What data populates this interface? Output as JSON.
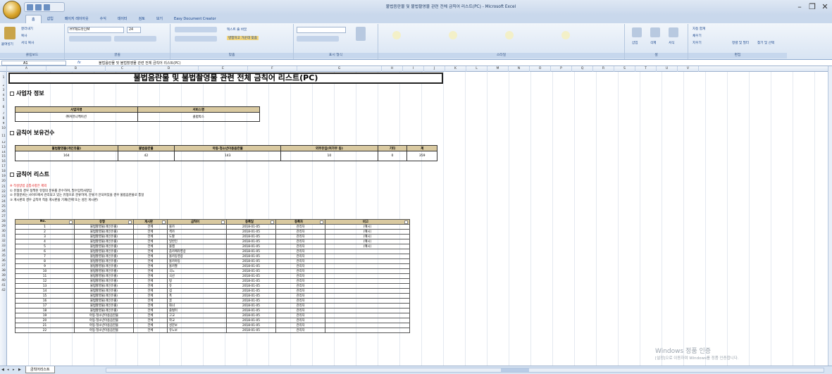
{
  "window": {
    "title": "불법음란물 및 불법촬영물 관련 전체 금칙어 리스트(PC) - Microsoft Excel"
  },
  "ribbon": {
    "tabs": [
      "홈",
      "삽입",
      "페이지 레이아웃",
      "수식",
      "데이터",
      "검토",
      "보기",
      "Easy Document Creator"
    ],
    "paste_label": "붙여넣기",
    "clipboard_items": [
      "잘라내기",
      "복사",
      "서식 복사"
    ],
    "font_name": "HY헤드라인M",
    "font_size": "24",
    "wrap_text": "텍스트 줄 바꿈",
    "merge_center": "병합하고 가운데 맞춤",
    "number_format": "",
    "insert": "삽입",
    "delete": "삭제",
    "format": "서식",
    "autosum": "자동 합계",
    "fill": "채우기",
    "clear": "지우기",
    "sort_filter": "정렬 및 필터",
    "find_select": "찾기 및 선택",
    "groups": [
      "클립보드",
      "글꼴",
      "맞춤",
      "표시 형식",
      "스타일",
      "셀",
      "편집"
    ]
  },
  "formula_bar": {
    "name_box": "A1",
    "fx": "fx",
    "value": "불법음란물 및 불법촬영물 관련 전체 금칙어 리스트(PC)"
  },
  "columns": [
    "A",
    "B",
    "C",
    "D",
    "E",
    "F",
    "G",
    "H",
    "I",
    "J",
    "K",
    "L",
    "M",
    "N",
    "O",
    "P",
    "Q",
    "R",
    "S",
    "T",
    "U",
    "V"
  ],
  "rows": [
    "1",
    "2",
    "3",
    "4",
    "5",
    "6",
    "7",
    "8",
    "9",
    "10",
    "11",
    "12",
    "13",
    "14",
    "15",
    "16",
    "17",
    "18",
    "19",
    "20",
    "21",
    "22",
    "23",
    "24",
    "25",
    "26",
    "27",
    "28",
    "29",
    "30",
    "31",
    "32",
    "33",
    "34",
    "35",
    "36",
    "37",
    "38",
    "39",
    "40",
    "41",
    "42"
  ],
  "sheet": {
    "title": "불법음란물 및 불법촬영물 관련 전체 금칙어 리스트(PC)",
    "section1": "사업자 정보",
    "biz_headers": [
      "사업자명",
      "서비스명"
    ],
    "biz_values": [
      "㈜커뮤니케이션",
      "클럽박스"
    ],
    "section2": "금칙어 보유건수",
    "count_headers": [
      "불법촬영물(개인유출)",
      "불법음란물",
      "아동·청소년이용음란물",
      "외부유입(여가부 등)",
      "기타",
      "계"
    ],
    "count_values": [
      "164",
      "42",
      "143",
      "10",
      "0",
      "359"
    ],
    "section3": "금칙어 리스트",
    "notes_red": "※ 작성방법 공통사항은 제외",
    "notes": [
      "① 유형의 경우 정책된 유형의 분류를 준수하며, 필수입력사항임",
      "② 유형분류는 사이트에서 관리되고 있는 유형으로 분류하며, 분류가 안되어있을 경우 불법음란물로 통일",
      "③ 게시판의 경우 금칙어 적용 게시판을 기재(전체 또는 성인 게시판)"
    ],
    "list_headers": [
      "No.",
      "유형",
      "게시판",
      "금칙어",
      "등록일",
      "등록자",
      "비고"
    ],
    "list_rows": [
      [
        "1",
        "불법촬영물(개인유출)",
        "전체",
        "몰카",
        "2018-01-05",
        "관리자",
        "(예시)"
      ],
      [
        "2",
        "불법촬영물(개인유출)",
        "전체",
        "섹카",
        "2018-01-05",
        "관리자",
        "(예시)"
      ],
      [
        "3",
        "불법촬영물(개인유출)",
        "전체",
        "도촬",
        "2018-01-05",
        "관리자",
        "(예시)"
      ],
      [
        "4",
        "불법촬영물(개인유출)",
        "전체",
        "일반인",
        "2018-01-05",
        "관리자",
        "(예시)"
      ],
      [
        "5",
        "불법촬영물(개인유출)",
        "전체",
        "몰캠",
        "2018-01-05",
        "관리자",
        "(예시)"
      ],
      [
        "6",
        "불법촬영물(개인유출)",
        "전체",
        "줌카메라영상",
        "2018-01-05",
        "관리자",
        ""
      ],
      [
        "7",
        "불법촬영물(개인유출)",
        "전체",
        "몰카동영상",
        "2018-01-05",
        "관리자",
        ""
      ],
      [
        "8",
        "불법촬영물(개인유출)",
        "전체",
        "몰카야동",
        "2018-01-05",
        "관리자",
        ""
      ],
      [
        "9",
        "불법촬영물(개인유출)",
        "전체",
        "몰카짤",
        "2018-01-05",
        "관리자",
        ""
      ],
      [
        "10",
        "불법촬영물(개인유출)",
        "전체",
        "국노",
        "2018-01-05",
        "관리자",
        ""
      ],
      [
        "11",
        "불법촬영물(개인유출)",
        "전체",
        "국산",
        "2018-01-05",
        "관리자",
        ""
      ],
      [
        "12",
        "불법촬영물(개인유출)",
        "전체",
        "펑",
        "2018-01-05",
        "관리자",
        ""
      ],
      [
        "13",
        "불법촬영물(개인유출)",
        "전체",
        "유",
        "2018-01-05",
        "관리자",
        ""
      ],
      [
        "14",
        "불법촬영물(개인유출)",
        "전체",
        "섭",
        "2018-01-05",
        "관리자",
        ""
      ],
      [
        "15",
        "불법촬영물(개인유출)",
        "전체",
        "폭",
        "2018-01-05",
        "관리자",
        ""
      ],
      [
        "16",
        "불법촬영물(개인유출)",
        "전체",
        "골",
        "2018-01-05",
        "관리자",
        ""
      ],
      [
        "17",
        "불법촬영물(개인유출)",
        "전체",
        "화녀",
        "2018-01-05",
        "관리자",
        ""
      ],
      [
        "18",
        "불법촬영물(개인유출)",
        "전체",
        "쓸벌이",
        "2018-01-05",
        "관리자",
        ""
      ],
      [
        "19",
        "아동·청소년이용음란물",
        "전체",
        "고교",
        "2018-01-05",
        "관리자",
        ""
      ],
      [
        "20",
        "아동·청소년이용음란물",
        "전체",
        "학교",
        "2018-01-05",
        "관리자",
        ""
      ],
      [
        "21",
        "아동·청소년이용음란물",
        "전체",
        "성문보",
        "2018-01-05",
        "관리자",
        ""
      ],
      [
        "22",
        "아동·청소년이용음란물",
        "전체",
        "유노보",
        "2018-01-05",
        "관리자",
        ""
      ]
    ]
  },
  "sheet_tabs": [
    "금칙어리스트"
  ],
  "watermark": {
    "line1": "Windows 정품 인증",
    "line2": "[설정]으로 이동하여 Windows를 정품 인증합니다."
  }
}
